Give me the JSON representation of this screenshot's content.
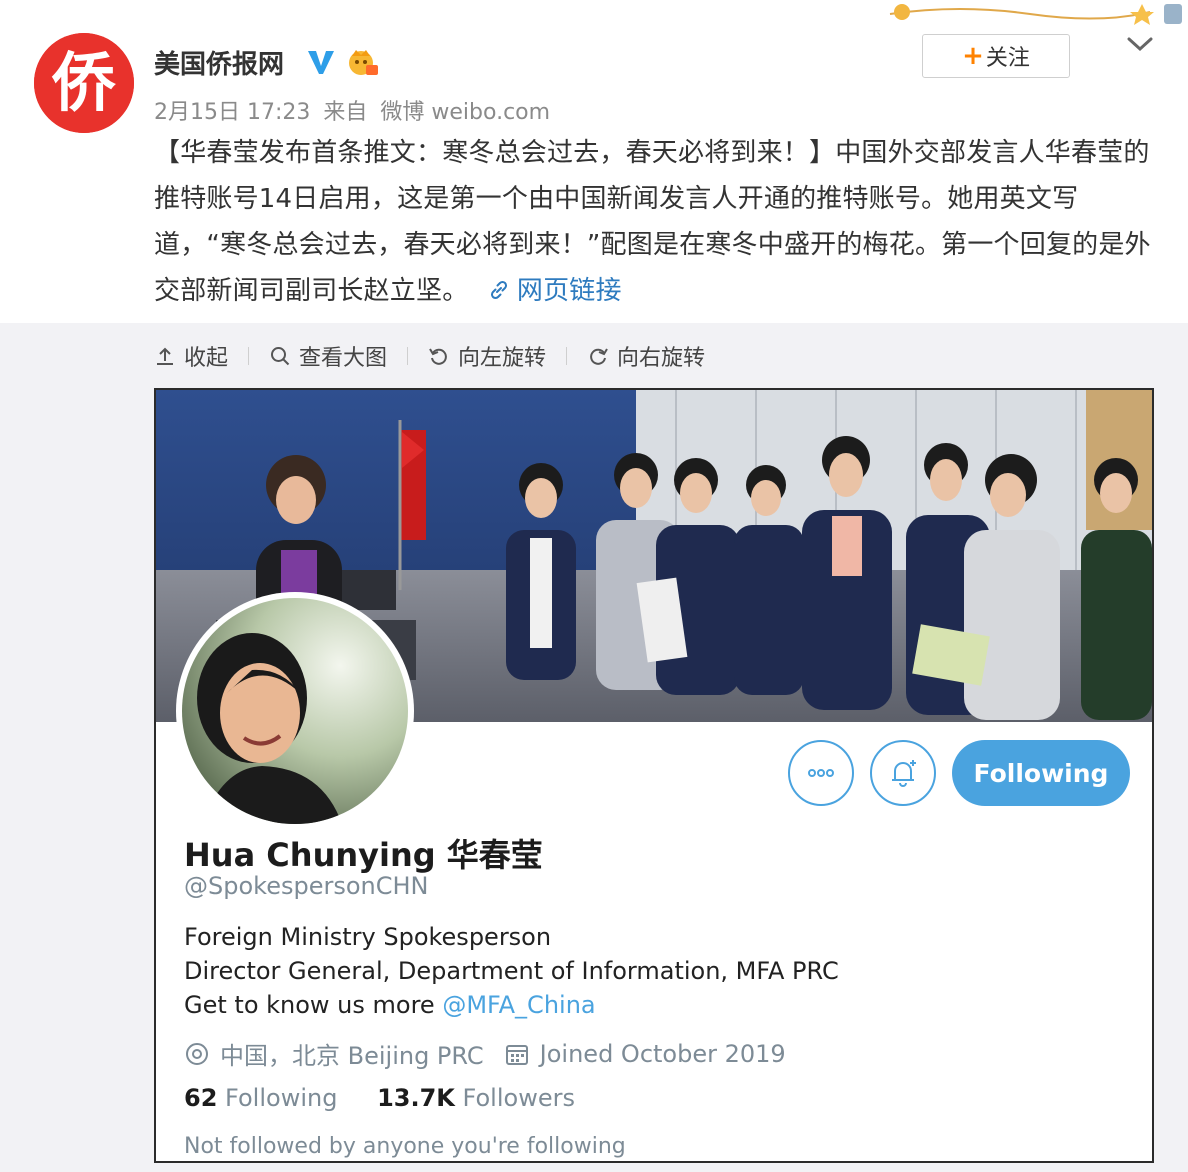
{
  "post": {
    "username": "美国侨报网",
    "avatar_char": "侨",
    "date": "2月15日 17:23",
    "source_prefix": "来自",
    "source": "微博 weibo.com",
    "follow_label": "关注",
    "text": "【华春莹发布首条推文：寒冬总会过去，春天必将到来！】中国外交部发言人华春莹的推特账号14日启用，这是第一个由中国新闻发言人开通的推特账号。她用英文写道，“寒冬总会过去，春天必将到来！”配图是在寒冬中盛开的梅花。第一个回复的是外交部新闻司副司长赵立坚。",
    "link_label": "网页链接",
    "icons": [
      "verified-icon",
      "vip-icon",
      "chevron-down-icon",
      "link-icon"
    ]
  },
  "toolbar": {
    "collapse": "收起",
    "view_large": "查看大图",
    "rotate_left": "向左旋转",
    "rotate_right": "向右旋转"
  },
  "tweet_profile": {
    "name": "Hua Chunying 华春莹",
    "handle": "@SpokespersonCHN",
    "bio_line1": "Foreign Ministry Spokesperson",
    "bio_line2": "Director General, Department of Information, MFA PRC",
    "bio_line3_prefix": "Get to know us more",
    "bio_mention": "@MFA_China",
    "location": "中国，北京 Beijing PRC",
    "joined": "Joined October 2019",
    "following_count": "62",
    "following_label": "Following",
    "followers_count": "13.7K",
    "followers_label": "Followers",
    "not_followed": "Not followed by anyone you're following",
    "following_button": "Following"
  },
  "colors": {
    "weibo_orange": "#ff8200",
    "link_blue": "#2e7bbf",
    "twitter_blue": "#4aa3df",
    "avatar_red": "#e8322c"
  }
}
